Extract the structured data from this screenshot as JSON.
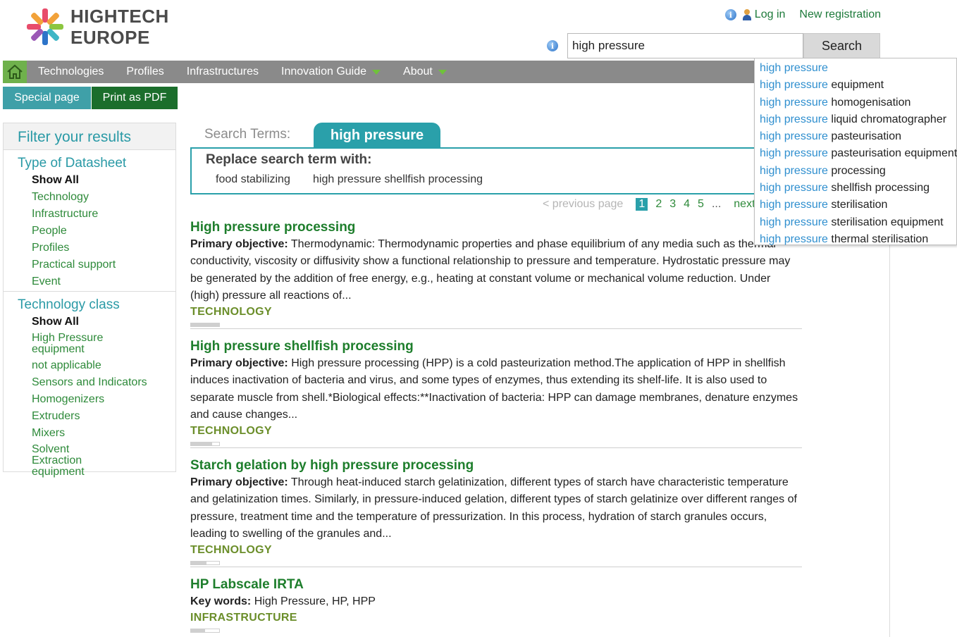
{
  "header": {
    "logo_line1": "HIGHTECH",
    "logo_line2": "EUROPE",
    "login": "Log in",
    "registration": "New registration"
  },
  "search": {
    "value": "high pressure",
    "button": "Search"
  },
  "nav": {
    "items": [
      "Technologies",
      "Profiles",
      "Infrastructures",
      "Innovation Guide",
      "About"
    ]
  },
  "actions": {
    "special": "Special page",
    "pdf": "Print as PDF"
  },
  "sidebar": {
    "title": "Filter your results",
    "groups": [
      {
        "title": "Type of Datasheet",
        "show_all": "Show All",
        "items": [
          "Technology",
          "Infrastructure",
          "People",
          "Profiles",
          "Practical support",
          "Event"
        ]
      },
      {
        "title": "Technology class",
        "show_all": "Show All",
        "items": [
          "High Pressure equipment",
          "not applicable",
          "Sensors and Indicators",
          "Homogenizers",
          "Extruders",
          "Mixers",
          "Solvent Extraction equipment"
        ]
      }
    ]
  },
  "main": {
    "search_terms_label": "Search Terms:",
    "search_term": "high pressure",
    "replace_title": "Replace search term with:",
    "replace_options": [
      "food stabilizing",
      "high pressure shellfish processing"
    ],
    "pager": {
      "prev": "< previous page",
      "pages": [
        "1",
        "2",
        "3",
        "4",
        "5"
      ],
      "current": "1",
      "dots": "...",
      "next": "next"
    },
    "results": [
      {
        "title": "High pressure processing",
        "label": "Primary objective:",
        "text": "Thermodynamic: Thermodynamic properties and phase equilibrium of any media such as thermal conductivity, viscosity or diffusivity show a functional relationship to pressure and temperature. Hydrostatic pressure may be generated by the addition of free energy, e.g., heating at constant volume or mechanical volume reduction. Under (high) pressure all reactions of...",
        "type": "TECHNOLOGY",
        "rating": 1.0
      },
      {
        "title": "High pressure shellfish processing",
        "label": "Primary objective:",
        "text": "High pressure processing (HPP) is a cold pasteurization method.The application of HPP in shellfish induces inactivation of bacteria and virus, and some types of enzymes, thus extending its shelf-life. It is also used to separate muscle from shell.*Biological effects:**Inactivation of bacteria: HPP can damage membranes, denature enzymes and cause changes...",
        "type": "TECHNOLOGY",
        "rating": 0.75
      },
      {
        "title": "Starch gelation by high pressure processing",
        "label": "Primary objective:",
        "text": "Through heat-induced starch gelatinization, different types of starch have characteristic temperature and gelatinization times. Similarly, in pressure-induced gelation, different types of starch gelatinize over different ranges of pressure, treatment time and the temperature of pressurization. In this process, hydration of starch granules occurs, leading to swelling of the granules and...",
        "type": "TECHNOLOGY",
        "rating": 0.55
      },
      {
        "title": "HP Labscale IRTA",
        "label": "Key words:",
        "text": "High Pressure, HP, HPP",
        "type": "INFRASTRUCTURE",
        "rating": 0.5
      }
    ]
  },
  "autocomplete": {
    "match": "high pressure",
    "suffixes": [
      "",
      " equipment",
      " homogenisation",
      " liquid chromatographer",
      " pasteurisation",
      " pasteurisation equipment",
      " processing",
      " shellfish processing",
      " sterilisation",
      " sterilisation equipment",
      " thermal sterilisation"
    ]
  },
  "colors": {
    "teal": "#2aa0aa",
    "green_link": "#1e7e2c",
    "nav_gray": "#8a8a8a",
    "home_green": "#6fb14c",
    "pdf_green": "#1b6e2c",
    "match_blue": "#2f8fcf"
  }
}
